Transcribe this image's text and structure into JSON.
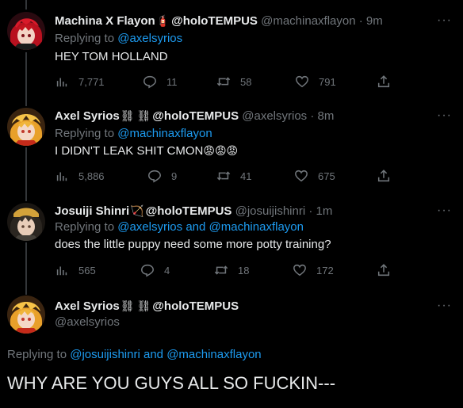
{
  "tweets": [
    {
      "name": "Machina X Flayon",
      "emoji": "🧯",
      "org": "@holoTEMPUS",
      "handle": "@machinaxflayon",
      "time": "· 9m",
      "replying_prefix": "Replying to",
      "replying_to": "@axelsyrios",
      "replying_join": "",
      "replying_to2": "",
      "text": "HEY TOM HOLLAND",
      "views": "7,771",
      "replies": "11",
      "retweets": "58",
      "likes": "791"
    },
    {
      "name": "Axel Syrios",
      "emoji": "⛓",
      "org": "@holoTEMPUS",
      "handle": "@axelsyrios",
      "time": "· 8m",
      "replying_prefix": "Replying to",
      "replying_to": "@machinaxflayon",
      "replying_join": "",
      "replying_to2": "",
      "text": "I DIDN'T LEAK SHIT CMON",
      "text_emoji": "😡😡😡",
      "views": "5,886",
      "replies": "9",
      "retweets": "41",
      "likes": "675"
    },
    {
      "name": "Josuiji Shinri",
      "emoji": "🏹",
      "org": "@holoTEMPUS",
      "handle": "@josuijishinri",
      "time": "· 1m",
      "replying_prefix": "Replying to",
      "replying_to": "@axelsyrios",
      "replying_join": "and",
      "replying_to2": "@machinaxflayon",
      "text": "does the little puppy need some more potty training?",
      "views": "565",
      "replies": "4",
      "retweets": "18",
      "likes": "172"
    }
  ],
  "main_tweet": {
    "name": "Axel Syrios",
    "emoji": "⛓",
    "org": "@holoTEMPUS",
    "handle": "@axelsyrios",
    "replying_prefix": "Replying to",
    "replying_to": "@josuijishinri",
    "replying_join": "and",
    "replying_to2": "@machinaxflayon",
    "text": "WHY ARE YOU GUYS ALL SO FUCKIN---"
  },
  "more_icon": "···",
  "icons": [
    "views-icon",
    "reply-icon",
    "retweet-icon",
    "like-icon",
    "share-icon",
    "more-icon"
  ],
  "colors": {
    "background": "#000000",
    "text": "#e7e9ea",
    "secondary": "#71767b",
    "link": "#1d9bf0",
    "line": "#333639"
  }
}
